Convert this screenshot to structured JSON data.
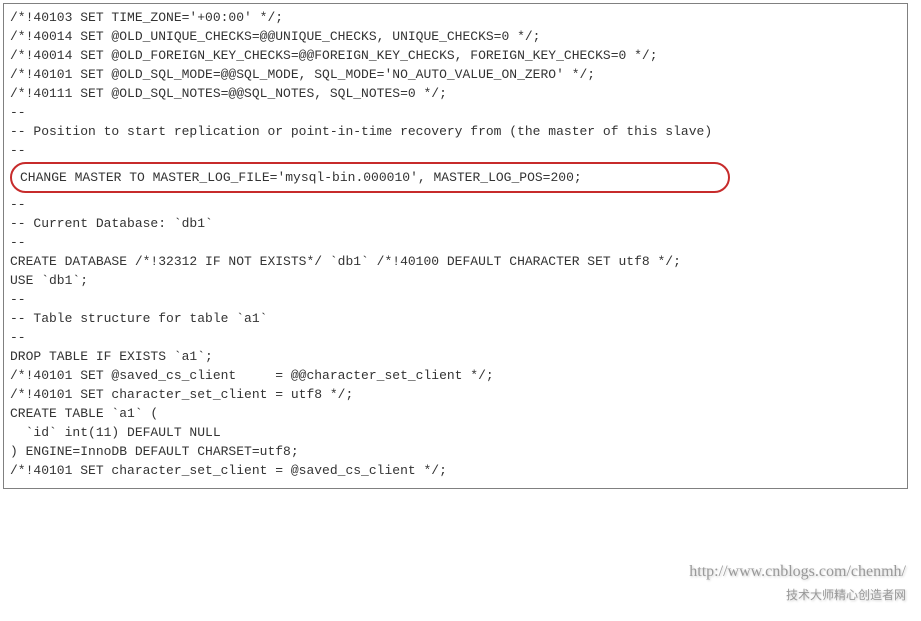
{
  "lines": {
    "l1": "/*!40103 SET TIME_ZONE='+00:00' */;",
    "l2": "/*!40014 SET @OLD_UNIQUE_CHECKS=@@UNIQUE_CHECKS, UNIQUE_CHECKS=0 */;",
    "l3": "/*!40014 SET @OLD_FOREIGN_KEY_CHECKS=@@FOREIGN_KEY_CHECKS, FOREIGN_KEY_CHECKS=0 */;",
    "l4": "/*!40101 SET @OLD_SQL_MODE=@@SQL_MODE, SQL_MODE='NO_AUTO_VALUE_ON_ZERO' */;",
    "l5": "/*!40111 SET @OLD_SQL_NOTES=@@SQL_NOTES, SQL_NOTES=0 */;",
    "l6": "",
    "l7": "--",
    "l8": "-- Position to start replication or point-in-time recovery from (the master of this slave)",
    "l9": "--",
    "l10": "",
    "l11": "CHANGE MASTER TO MASTER_LOG_FILE='mysql-bin.000010', MASTER_LOG_POS=200;",
    "l12": "",
    "l13": "--",
    "l14": "-- Current Database: `db1`",
    "l15": "--",
    "l16": "",
    "l17": "CREATE DATABASE /*!32312 IF NOT EXISTS*/ `db1` /*!40100 DEFAULT CHARACTER SET utf8 */;",
    "l18": "",
    "l19": "USE `db1`;",
    "l20": "",
    "l21": "--",
    "l22": "-- Table structure for table `a1`",
    "l23": "--",
    "l24": "",
    "l25": "DROP TABLE IF EXISTS `a1`;",
    "l26": "/*!40101 SET @saved_cs_client     = @@character_set_client */;",
    "l27": "/*!40101 SET character_set_client = utf8 */;",
    "l28": "CREATE TABLE `a1` (",
    "l29": "  `id` int(11) DEFAULT NULL",
    "l30": ") ENGINE=InnoDB DEFAULT CHARSET=utf8;",
    "l31": "/*!40101 SET character_set_client = @saved_cs_client */;"
  },
  "watermark": {
    "url": "http://www.cnblogs.com/chenmh/",
    "extra": "技术大师精心创造者网"
  }
}
